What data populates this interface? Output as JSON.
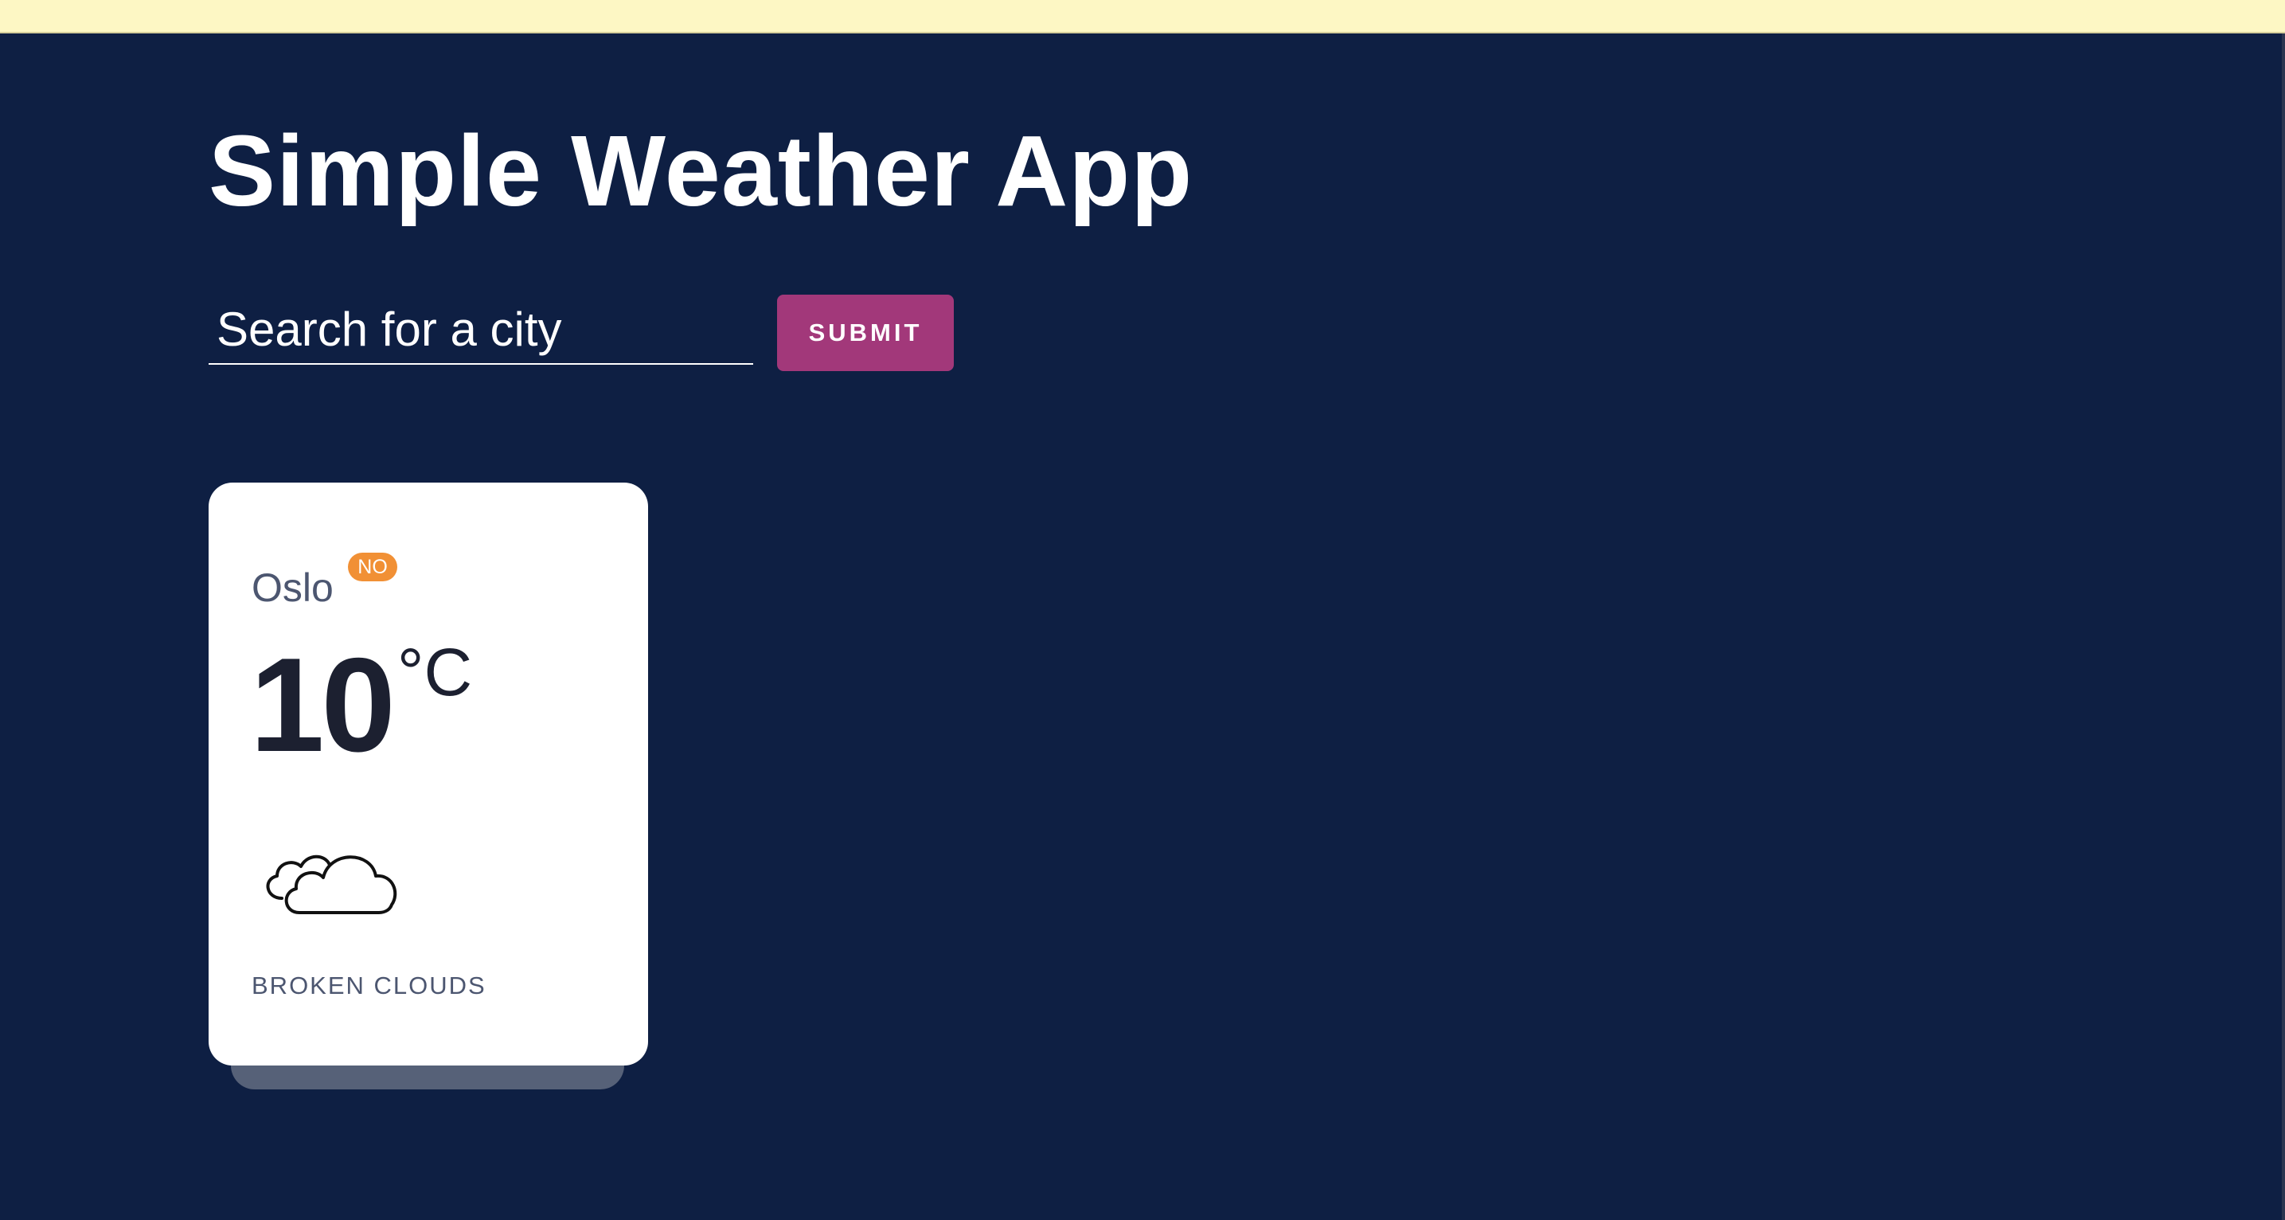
{
  "app": {
    "title": "Simple Weather App"
  },
  "search": {
    "placeholder": "Search for a city",
    "value": "",
    "submit_label": "SUBMIT"
  },
  "cards": [
    {
      "city": "Oslo",
      "country_code": "NO",
      "temperature": "10",
      "unit": "°C",
      "icon": "broken-clouds-icon",
      "description": "BROKEN CLOUDS"
    }
  ],
  "colors": {
    "background": "#0e1f43",
    "top_strip": "#fdf7c4",
    "submit_button": "#a2387a",
    "country_badge": "#f19035",
    "card": "#ffffff",
    "card_shadow": "#566178",
    "muted_text": "#4c5670"
  }
}
